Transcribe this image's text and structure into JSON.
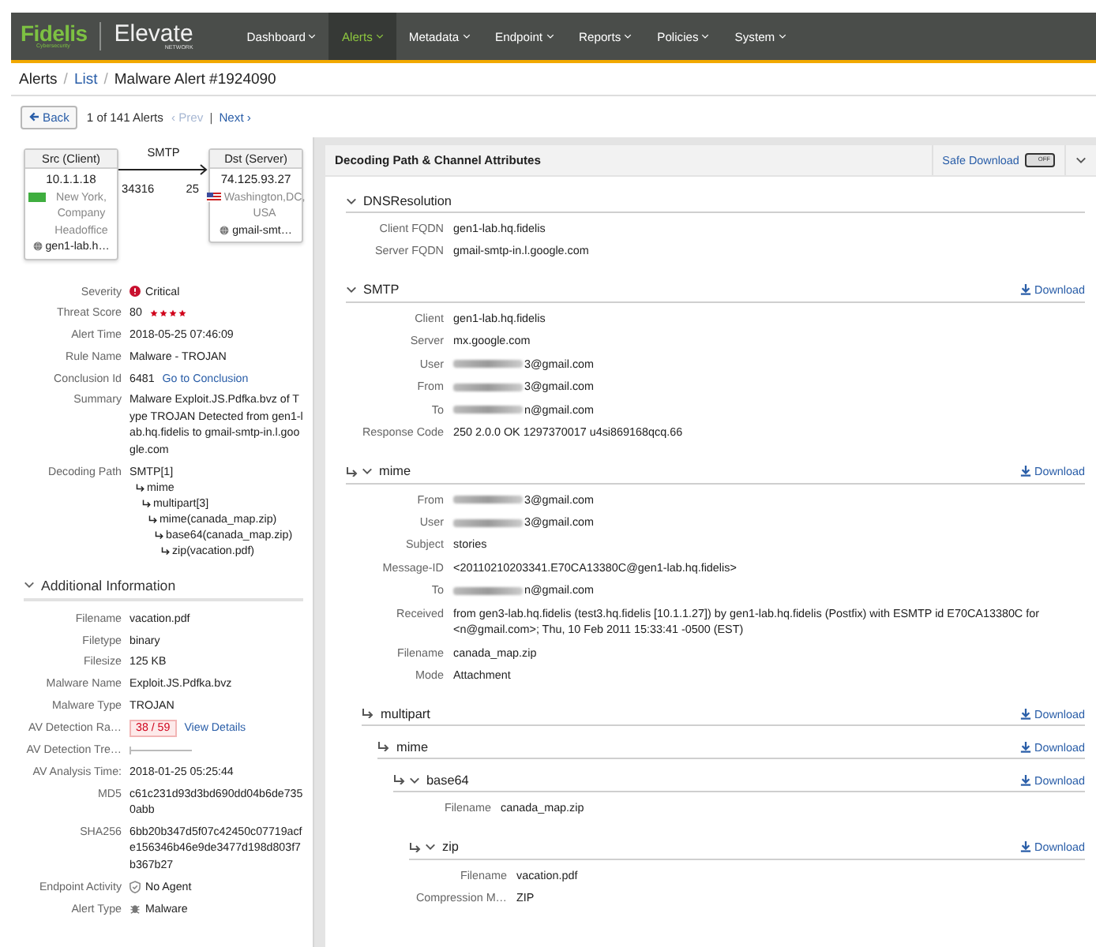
{
  "nav": {
    "brand": "Fidelis",
    "brand_tagline": "Cybersecurity",
    "product": "Elevate",
    "product_tagline": "NETWORK",
    "items": [
      {
        "label": "Dashboard",
        "selected": false
      },
      {
        "label": "Alerts",
        "selected": true
      },
      {
        "label": "Metadata",
        "selected": false
      },
      {
        "label": "Endpoint",
        "selected": false
      },
      {
        "label": "Reports",
        "selected": false
      },
      {
        "label": "Policies",
        "selected": false
      },
      {
        "label": "System",
        "selected": false
      }
    ]
  },
  "breadcrumb": {
    "separator": "/",
    "items": [
      {
        "label": "Alerts",
        "kind": "text"
      },
      {
        "label": "List",
        "kind": "link"
      },
      {
        "label": "Malware Alert #1924090",
        "kind": "current"
      }
    ]
  },
  "pager": {
    "back": "Back",
    "count": "1 of 141 Alerts",
    "prev": {
      "label": "‹ Prev",
      "disabled": true
    },
    "separator": "|",
    "next": {
      "label": "Next ›",
      "disabled": false
    }
  },
  "flow": {
    "protocol": "SMTP",
    "src": {
      "title": "Src (Client)",
      "ip": "10.1.1.18",
      "location": "New York, Company Headoffice",
      "host": "gen1-lab.h…",
      "port": "34316"
    },
    "dst": {
      "title": "Dst (Server)",
      "ip": "74.125.93.27",
      "location": "Washington,DC, USA",
      "host": "gmail-smt…",
      "port": "25"
    }
  },
  "summary": [
    {
      "label": "Severity",
      "kind": "severity",
      "value": "Critical",
      "color": "#c8102e"
    },
    {
      "label": "Threat Score",
      "kind": "score",
      "value": "80",
      "stars": 4
    },
    {
      "label": "Alert Time",
      "kind": "text",
      "value": "2018-05-25 07:46:09"
    },
    {
      "label": "Rule Name",
      "kind": "text",
      "value": "Malware - TROJAN"
    },
    {
      "label": "Conclusion Id",
      "kind": "link",
      "value": "6481",
      "link": "Go to Conclusion"
    },
    {
      "label": "Summary",
      "kind": "text",
      "value": "Malware Exploit.JS.Pdfka.bvz of Type TROJAN Detected from gen1-lab.hq.fidelis to gmail-smtp-in.l.google.com"
    },
    {
      "label": "Decoding Path",
      "kind": "tree",
      "tree": [
        {
          "label": "SMTP[1]",
          "children": [
            {
              "label": "mime",
              "children": [
                {
                  "label": "multipart[3]",
                  "children": [
                    {
                      "label": "mime(canada_map.zip)",
                      "children": [
                        {
                          "label": "base64(canada_map.zip)",
                          "children": [
                            {
                              "label": "zip(vacation.pdf)"
                            }
                          ]
                        }
                      ]
                    }
                  ]
                }
              ]
            }
          ]
        }
      ]
    }
  ],
  "additional": {
    "title": "Additional Information",
    "expanded": true,
    "rows": [
      {
        "label": "Filename",
        "kind": "text",
        "value": "vacation.pdf"
      },
      {
        "label": "Filetype",
        "kind": "text",
        "value": "binary"
      },
      {
        "label": "Filesize",
        "kind": "text",
        "value": "125 KB"
      },
      {
        "label": "Malware Name",
        "kind": "text",
        "value": "Exploit.JS.Pdfka.bvz"
      },
      {
        "label": "Malware Type",
        "kind": "text",
        "value": "TROJAN"
      },
      {
        "label": "AV Detection Ra…",
        "kind": "ratio",
        "value": "38 / 59",
        "link": "View Details"
      },
      {
        "label": "AV Detection Tre…",
        "kind": "trend"
      },
      {
        "label": "AV Analysis Time:",
        "kind": "text",
        "value": "2018-01-25 05:25:44"
      },
      {
        "label": "MD5",
        "kind": "text",
        "value": "c61c231d93d3bd690dd04b6de7350abb"
      },
      {
        "label": "SHA256",
        "kind": "text",
        "value": "6bb20b347d5f07c42450c07719acfe156346b46e9de3477d198d803f7b367b27"
      },
      {
        "label": "Endpoint Activity",
        "kind": "agent",
        "value": "No Agent"
      },
      {
        "label": "Alert Type",
        "kind": "type",
        "value": "Malware"
      }
    ]
  },
  "channels": {
    "title": "Decoding Path & Channel Attributes",
    "safe_download": "Safe Download",
    "toggle": {
      "label": "OFF",
      "on": false
    },
    "sections": [
      {
        "title": "DNSResolution",
        "expanded": true,
        "fields": [
          {
            "label": "Client FQDN",
            "value": "gen1-lab.hq.fidelis"
          },
          {
            "label": "Server FQDN",
            "value": "gmail-smtp-in.l.google.com"
          }
        ]
      },
      {
        "title": "SMTP",
        "expanded": true,
        "download": "Download",
        "fields": [
          {
            "label": "Client",
            "value": "gen1-lab.hq.fidelis"
          },
          {
            "label": "Server",
            "value": "mx.google.com"
          },
          {
            "label": "User",
            "value": "3@gmail.com",
            "redacted": true
          },
          {
            "label": "From",
            "value": "3@gmail.com",
            "redacted": true
          },
          {
            "label": "To",
            "value": "n@gmail.com",
            "redacted": true
          },
          {
            "label": "Response Code",
            "value": "250 2.0.0 OK 1297370017 u4si869168qcq.66"
          }
        ],
        "children": [
          {
            "title": "mime",
            "expanded": true,
            "download": "Download",
            "fields": [
              {
                "label": "From",
                "value": "3@gmail.com",
                "redacted": true
              },
              {
                "label": "User",
                "value": "3@gmail.com",
                "redacted": true
              },
              {
                "label": "Subject",
                "value": "stories"
              },
              {
                "label": "Message-ID",
                "value": "<20110210203341.E70CA13380C@gen1-lab.hq.fidelis>"
              },
              {
                "label": "To",
                "value": "n@gmail.com",
                "redacted": true
              },
              {
                "label": "Received",
                "value": "from gen3-lab.hq.fidelis (test3.hq.fidelis [10.1.1.27]) by gen1-lab.hq.fidelis (Postfix) with ESMTP id E70CA13380C for <n@gmail.com>; Thu, 10 Feb 2011 15:33:41 -0500 (EST)"
              },
              {
                "label": "Filename",
                "value": "canada_map.zip"
              },
              {
                "label": "Mode",
                "value": "Attachment"
              }
            ],
            "children": [
              {
                "title": "multipart",
                "expanded": false,
                "download": "Download",
                "children": [
                  {
                    "title": "mime",
                    "expanded": false,
                    "download": "Download",
                    "children": [
                      {
                        "title": "base64",
                        "expanded": true,
                        "download": "Download",
                        "fields": [
                          {
                            "label": "Filename",
                            "value": "canada_map.zip"
                          }
                        ],
                        "children": [
                          {
                            "title": "zip",
                            "expanded": true,
                            "download": "Download",
                            "fields": [
                              {
                                "label": "Filename",
                                "value": "vacation.pdf"
                              },
                              {
                                "label": "Compression M…",
                                "value": "ZIP"
                              }
                            ]
                          }
                        ]
                      }
                    ]
                  }
                ]
              }
            ]
          }
        ]
      }
    ]
  }
}
